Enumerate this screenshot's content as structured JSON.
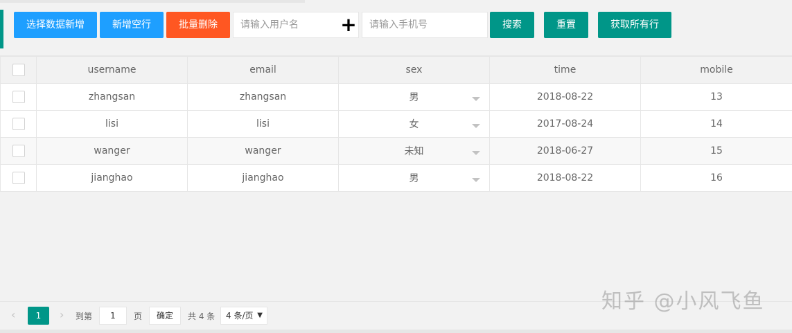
{
  "toolbar": {
    "select_add_label": "选择数据新增",
    "add_empty_label": "新增空行",
    "batch_delete_label": "批量删除",
    "username_placeholder": "请输入用户名",
    "plus_icon": "+",
    "mobile_placeholder": "请输入手机号",
    "search_label": "搜索",
    "reset_label": "重置",
    "get_all_rows_label": "获取所有行"
  },
  "table": {
    "columns": [
      "username",
      "email",
      "sex",
      "time",
      "mobile"
    ],
    "rows": [
      {
        "username": "zhangsan",
        "email": "zhangsan",
        "sex": "男",
        "time": "2018-08-22",
        "mobile": "13"
      },
      {
        "username": "lisi",
        "email": "lisi",
        "sex": "女",
        "time": "2017-08-24",
        "mobile": "14"
      },
      {
        "username": "wanger",
        "email": "wanger",
        "sex": "未知",
        "time": "2018-06-27",
        "mobile": "15"
      },
      {
        "username": "jianghao",
        "email": "jianghao",
        "sex": "男",
        "time": "2018-08-22",
        "mobile": "16"
      }
    ]
  },
  "pager": {
    "prev_icon": "‹",
    "current_page": "1",
    "next_icon": "›",
    "goto_label": "到第",
    "goto_value": "1",
    "page_unit": "页",
    "confirm_label": "确定",
    "total_label": "共 4 条",
    "limit_value": "4 条/页",
    "limit_caret": "▼"
  },
  "watermark": "知乎 @小风飞鱼",
  "colors": {
    "primary_green": "#009688",
    "blue": "#1e9fff",
    "red": "#ff5722"
  }
}
